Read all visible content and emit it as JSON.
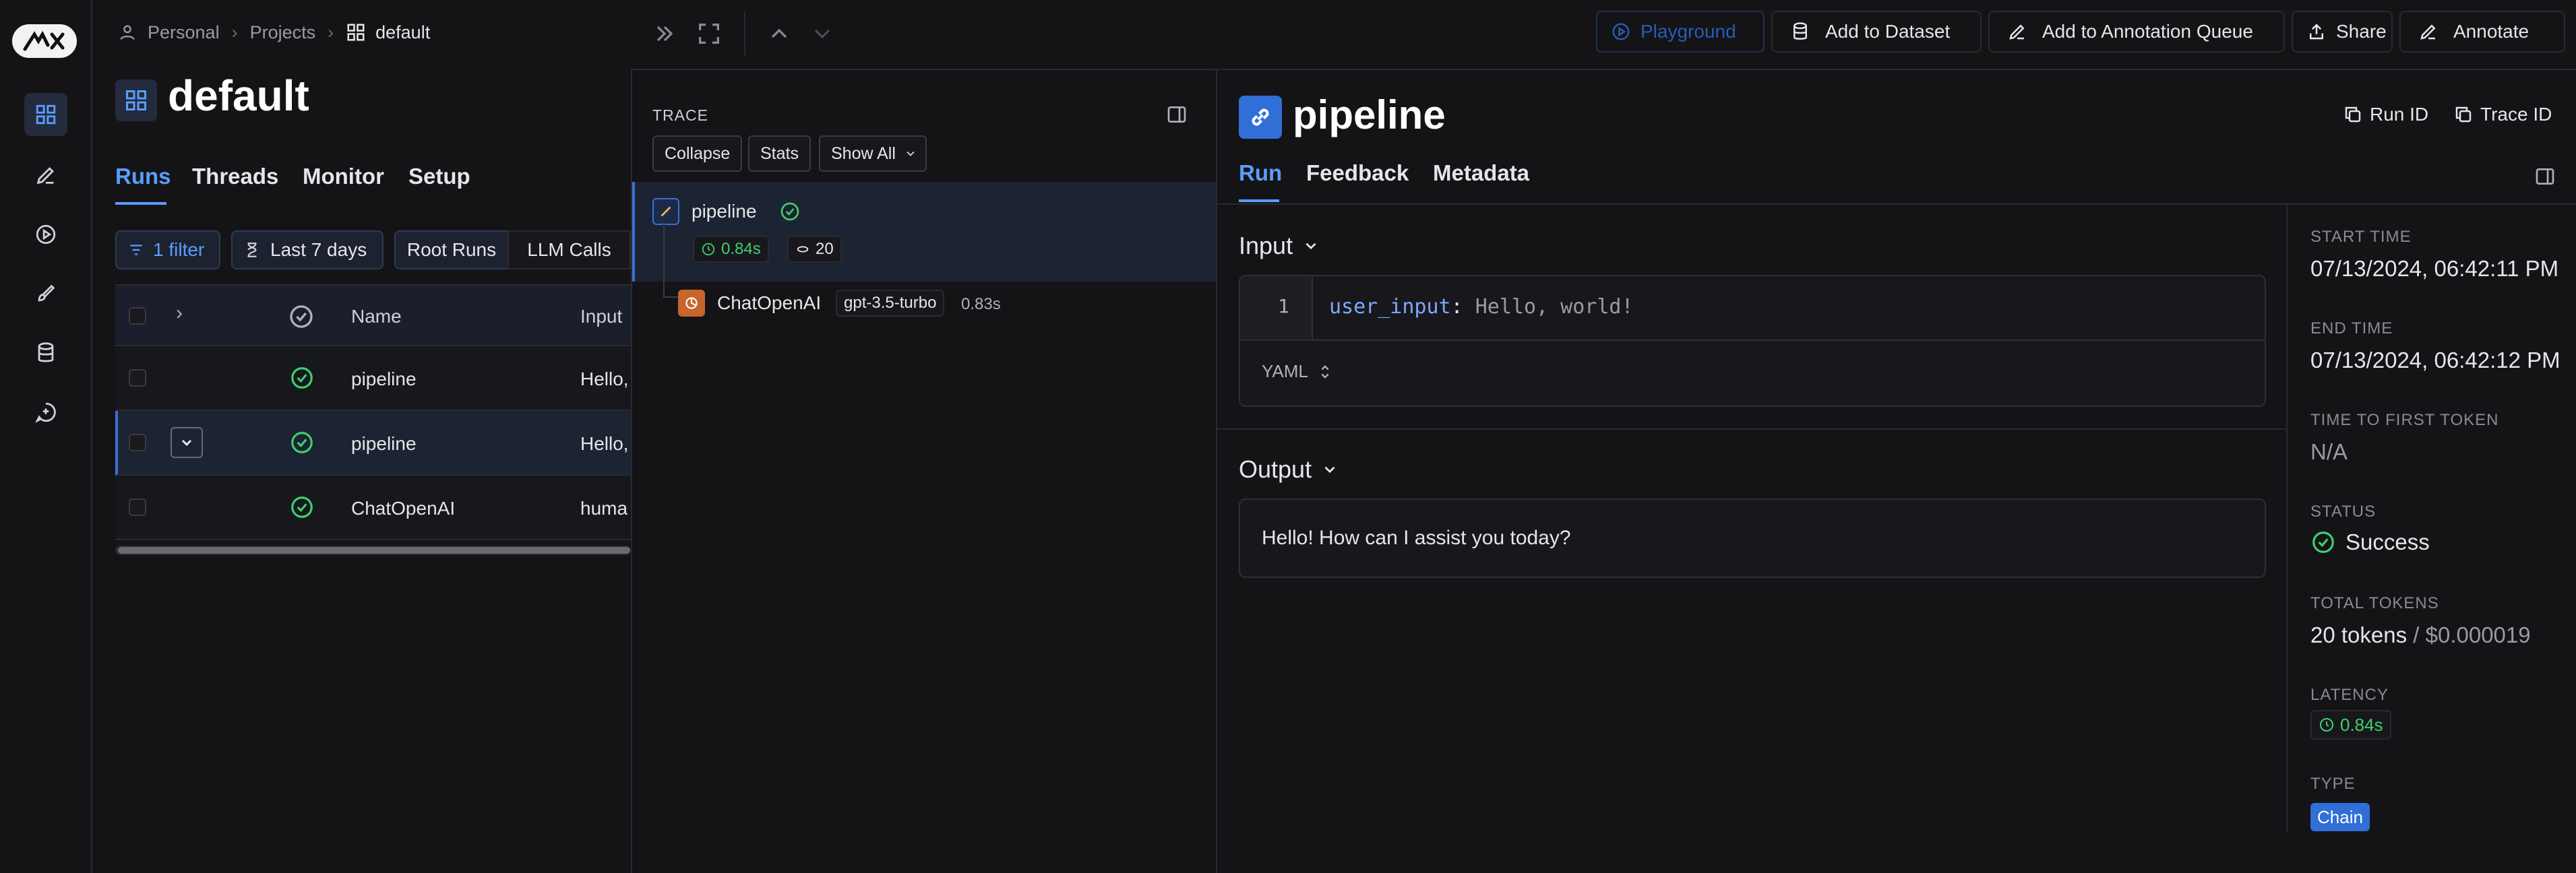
{
  "breadcrumb": {
    "personal": "Personal",
    "projects": "Projects",
    "current": "default"
  },
  "project": {
    "title": "default"
  },
  "runs_tabs": [
    "Runs",
    "Threads",
    "Monitor",
    "Setup"
  ],
  "filters": {
    "filter": "1 filter",
    "time": "Last 7 days",
    "root_runs": "Root Runs",
    "llm_calls": "LLM Calls"
  },
  "table": {
    "headers": {
      "name": "Name",
      "input": "Input"
    },
    "rows": [
      {
        "name": "pipeline",
        "input": "Hello,"
      },
      {
        "name": "pipeline",
        "input": "Hello,"
      },
      {
        "name": "ChatOpenAI",
        "input": "huma"
      }
    ]
  },
  "toolbar": {
    "playground": "Playground",
    "add_dataset": "Add to Dataset",
    "add_annotation": "Add to Annotation Queue",
    "share": "Share",
    "annotate": "Annotate"
  },
  "trace": {
    "label": "TRACE",
    "collapse": "Collapse",
    "stats": "Stats",
    "show_all": "Show All",
    "root": {
      "name": "pipeline",
      "latency": "0.84s",
      "tokens": "20"
    },
    "child": {
      "name": "ChatOpenAI",
      "model": "gpt-3.5-turbo",
      "latency": "0.83s"
    }
  },
  "detail": {
    "title": "pipeline",
    "run_id": "Run ID",
    "trace_id": "Trace ID",
    "tabs": [
      "Run",
      "Feedback",
      "Metadata"
    ],
    "input_title": "Input",
    "line_no": "1",
    "input_key": "user_input",
    "input_colon": ":",
    "input_value": "Hello, world!",
    "format": "YAML",
    "output_title": "Output",
    "output_text": "Hello! How can I assist you today?"
  },
  "meta": {
    "start_label": "START TIME",
    "start_value": "07/13/2024, 06:42:11 PM",
    "end_label": "END TIME",
    "end_value": "07/13/2024, 06:42:12 PM",
    "ttft_label": "TIME TO FIRST TOKEN",
    "ttft_value": "N/A",
    "status_label": "STATUS",
    "status_value": "Success",
    "tokens_label": "TOTAL TOKENS",
    "tokens_value": "20 tokens",
    "tokens_sep": " / ",
    "tokens_cost": "$0.000019",
    "latency_label": "LATENCY",
    "latency_value": "0.84s",
    "type_label": "TYPE",
    "type_value": "Chain"
  },
  "colors": {
    "accent": "#5b9dff",
    "success": "#3ecf6e",
    "chain_badge": "#2f6fd6"
  }
}
